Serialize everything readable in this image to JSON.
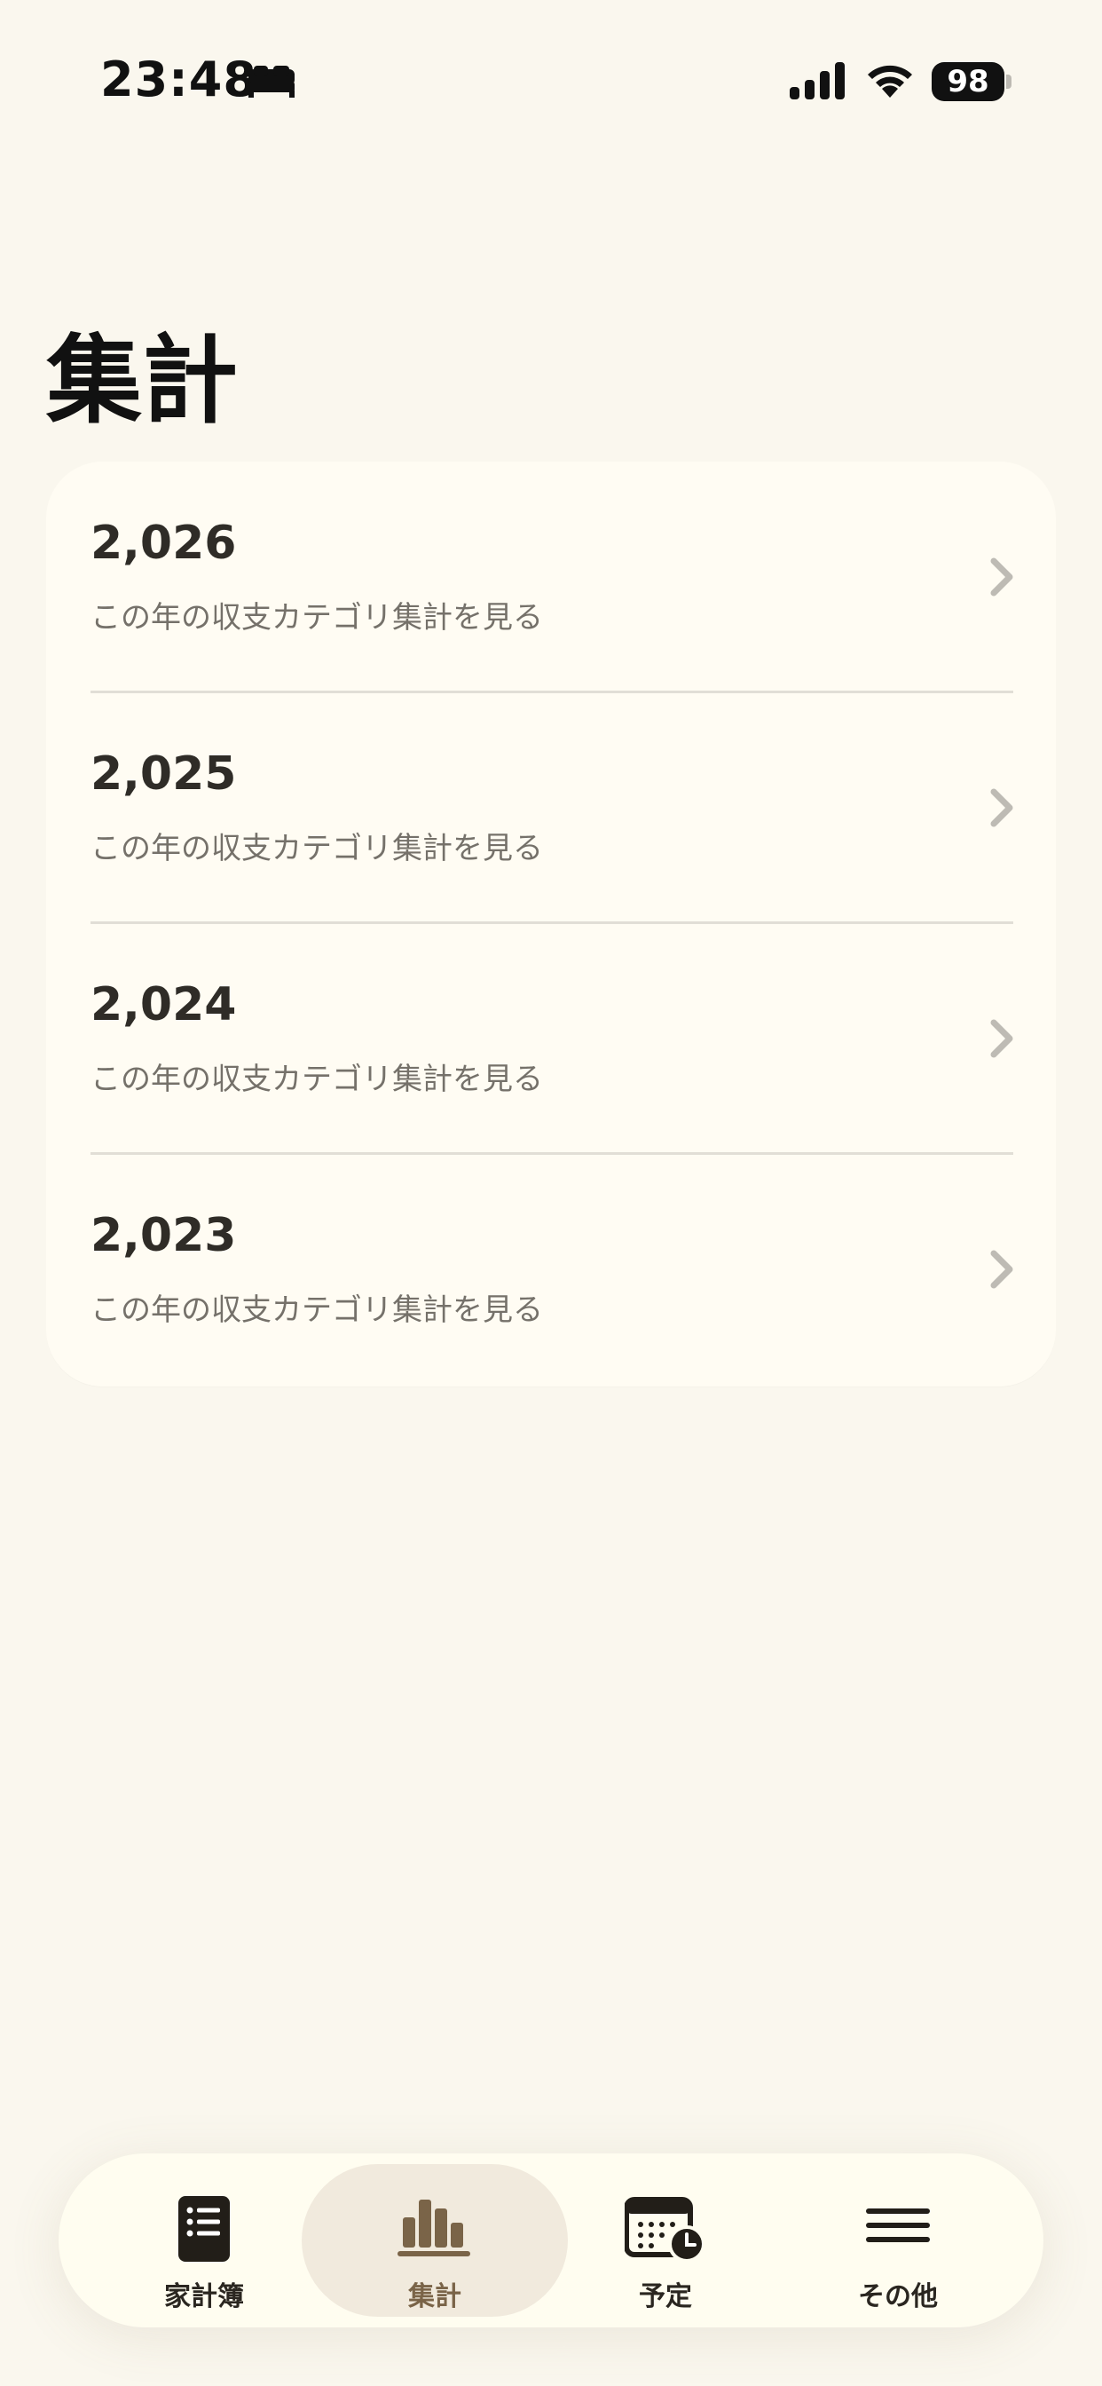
{
  "status_bar": {
    "time": "23:48",
    "battery": "98"
  },
  "page": {
    "title": "集計"
  },
  "years": [
    {
      "year": "2,026",
      "subtitle": "この年の収支カテゴリ集計を見る"
    },
    {
      "year": "2,025",
      "subtitle": "この年の収支カテゴリ集計を見る"
    },
    {
      "year": "2,024",
      "subtitle": "この年の収支カテゴリ集計を見る"
    },
    {
      "year": "2,023",
      "subtitle": "この年の収支カテゴリ集計を見る"
    }
  ],
  "tabs": [
    {
      "label": "家計簿",
      "icon": "ledger-icon"
    },
    {
      "label": "集計",
      "icon": "bar-chart-icon",
      "active": true
    },
    {
      "label": "予定",
      "icon": "calendar-clock-icon"
    },
    {
      "label": "その他",
      "icon": "menu-icon"
    }
  ],
  "colors": {
    "background": "#FAF7EE",
    "card": "#FFFCF3",
    "active_tab": "#F1EADD",
    "accent": "#7A6448"
  }
}
